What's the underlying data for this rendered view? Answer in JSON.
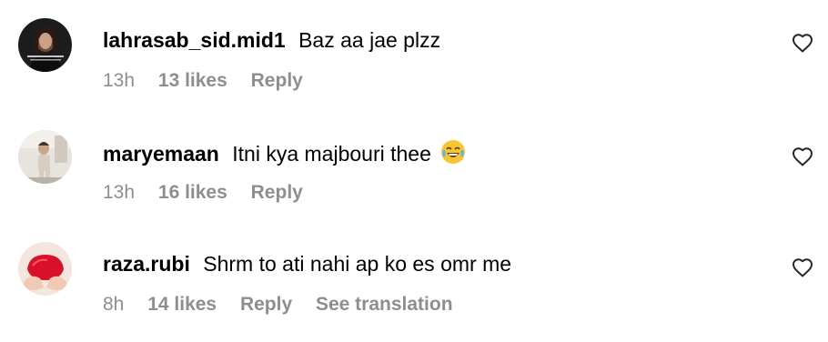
{
  "comments": [
    {
      "username": "lahrasab_sid.mid1",
      "text": "Baz aa jae plzz",
      "time": "13h",
      "likes": "13 likes",
      "reply": "Reply"
    },
    {
      "username": "maryemaan",
      "text": "Itni kya majbouri thee",
      "emoji": "face-with-tears-of-joy-emoji",
      "time": "13h",
      "likes": "16 likes",
      "reply": "Reply"
    },
    {
      "username": "raza.rubi",
      "text": "Shrm to ati nahi ap ko es omr me",
      "time": "8h",
      "likes": "14 likes",
      "reply": "Reply",
      "see_translation": "See translation"
    }
  ],
  "icons": {
    "like": "heart-outline-icon"
  }
}
